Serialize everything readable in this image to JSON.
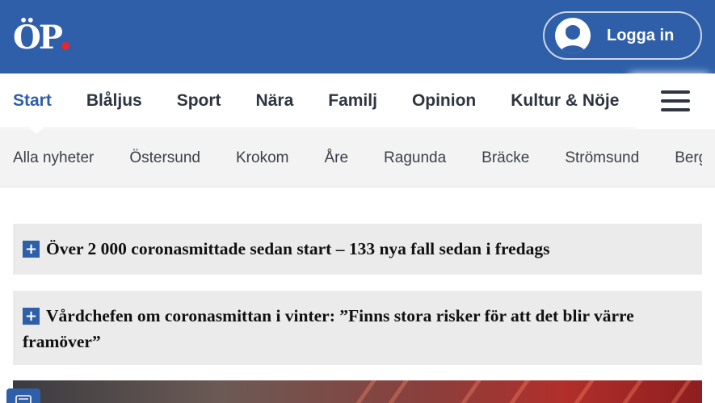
{
  "header": {
    "logo_text": "ÖP",
    "login_label": "Logga in",
    "login_icon": "user-avatar-icon"
  },
  "main_nav": {
    "items": [
      {
        "label": "Start",
        "active": true
      },
      {
        "label": "Blåljus",
        "active": false
      },
      {
        "label": "Sport",
        "active": false
      },
      {
        "label": "Nära",
        "active": false
      },
      {
        "label": "Familj",
        "active": false
      },
      {
        "label": "Opinion",
        "active": false
      },
      {
        "label": "Kultur & Nöje",
        "active": false
      }
    ],
    "menu_icon": "hamburger-menu-icon"
  },
  "sub_nav": {
    "items": [
      "Alla nyheter",
      "Östersund",
      "Krokom",
      "Åre",
      "Ragunda",
      "Bräcke",
      "Strömsund",
      "Berg"
    ]
  },
  "stories": [
    {
      "title": "Över 2 000 coronasmittade sedan start – 133 nya fall sedan i fredags",
      "icon": "plus-icon"
    },
    {
      "title": "Vårdchefen om coronasmittan i vinter: ”Finns stora risker för att det blir värre framöver”",
      "icon": "plus-icon"
    }
  ],
  "colors": {
    "brand_blue": "#2f5fa8",
    "logo_dot": "#e3262f",
    "nav_text": "#2e3440",
    "story_bg": "#ebebeb"
  }
}
